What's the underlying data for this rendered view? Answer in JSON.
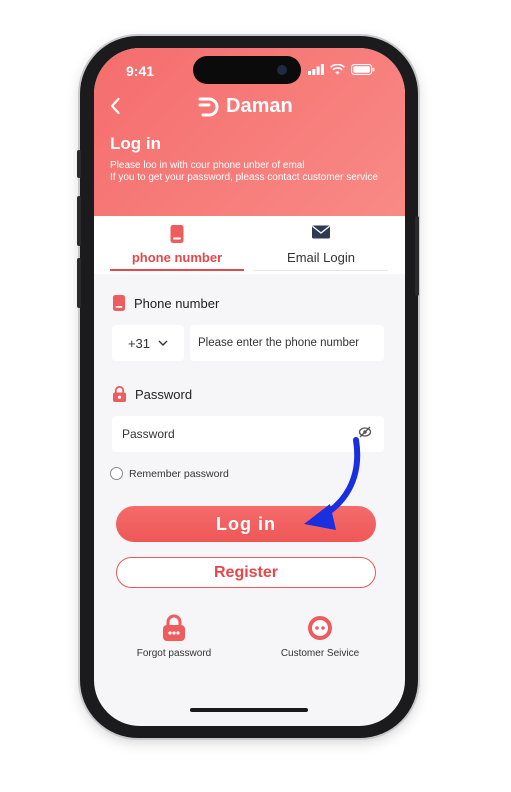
{
  "status_bar": {
    "time": "9:41"
  },
  "header": {
    "brand": "Daman",
    "title": "Log in",
    "subtitle_line1": "Please loo in with cour phone unber of emal",
    "subtitle_line2": "If you to get your password, pleass contact customer service"
  },
  "tabs": [
    {
      "label": "phone number",
      "active": true,
      "icon": "phone-icon"
    },
    {
      "label": "Email Login",
      "active": false,
      "icon": "envelope-icon"
    }
  ],
  "phone_section": {
    "label": "Phone number",
    "country_code": "+31",
    "placeholder": "Please enter the phone number"
  },
  "password_section": {
    "label": "Password",
    "placeholder": "Password"
  },
  "remember": {
    "label": "Remember password",
    "checked": false
  },
  "buttons": {
    "login": "Log in",
    "register": "Register"
  },
  "bottom": [
    {
      "label": "Forgot password",
      "icon": "lock-icon"
    },
    {
      "label": "Customer Seivice",
      "icon": "customer-service-icon"
    }
  ],
  "colors": {
    "accent": "#e8474a",
    "header_start": "#f56d6d",
    "header_end": "#f88a86",
    "arrow": "#1a2fe0"
  }
}
